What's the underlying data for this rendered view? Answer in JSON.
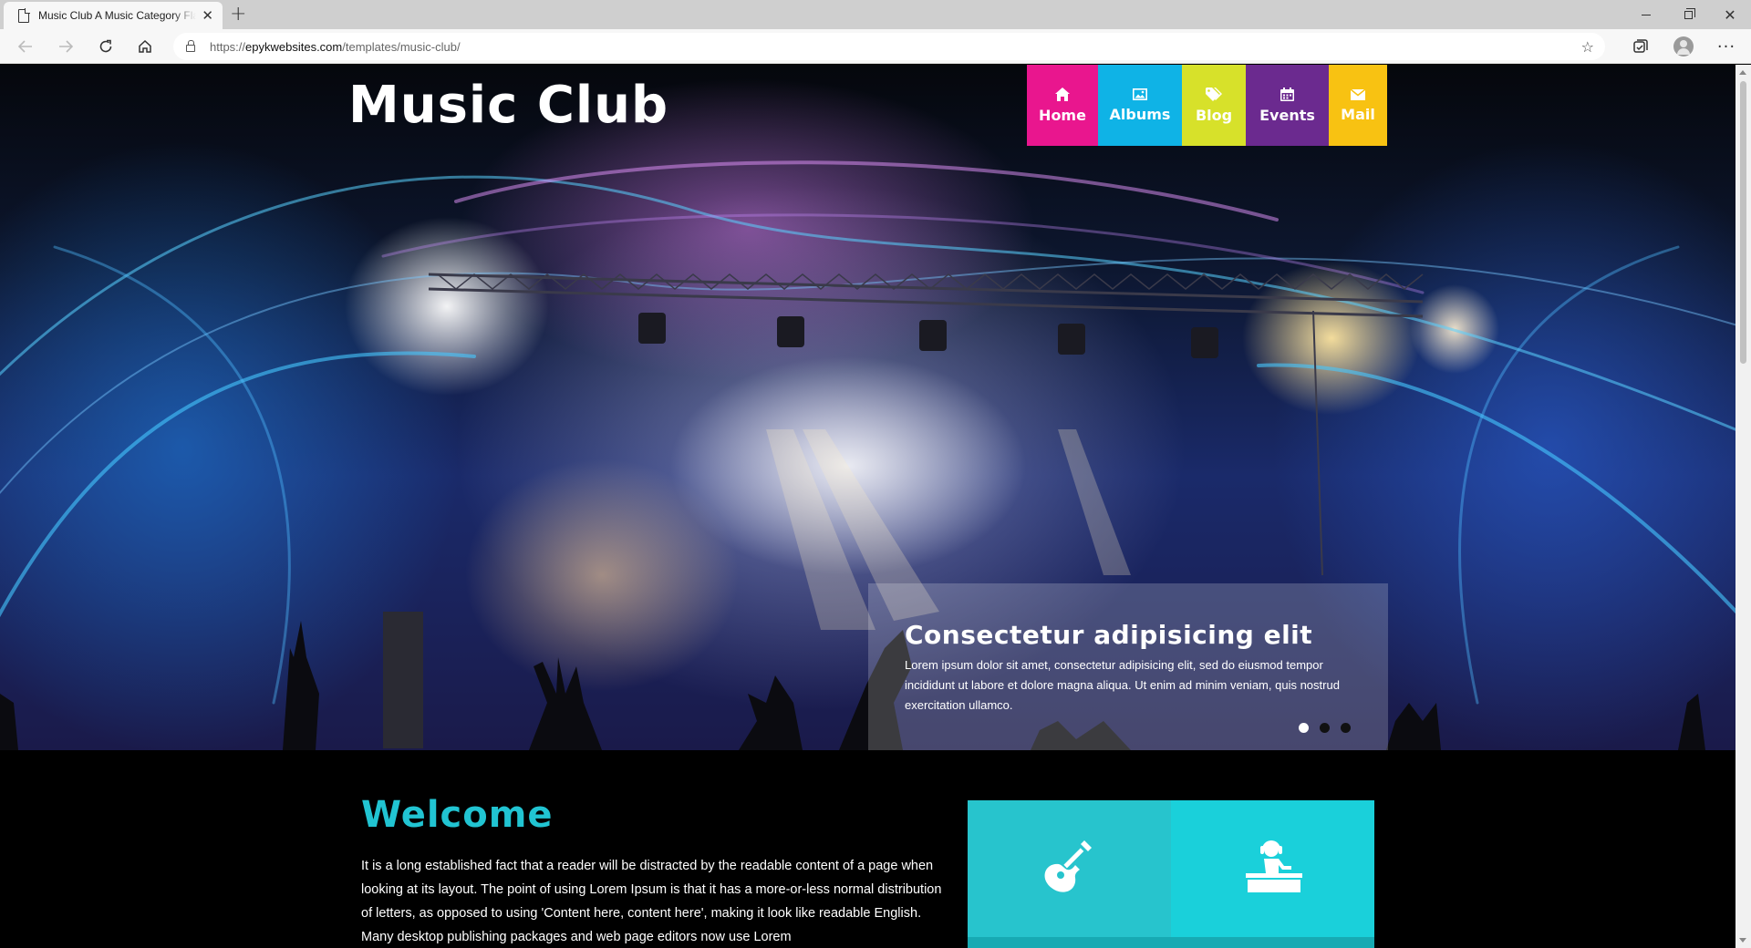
{
  "browser": {
    "tab_title": "Music Club A Music Category Flat Bootstrap Responsive Website Template",
    "tab_close": "✕",
    "new_tab": "+",
    "url_scheme": "https://",
    "url_host": "epykwebsites.com",
    "url_path": "/templates/music-club/"
  },
  "site": {
    "logo": "Music Club",
    "nav": [
      {
        "label": "Home",
        "icon": "home-icon",
        "color": "#e9168e"
      },
      {
        "label": "Albums",
        "icon": "picture-icon",
        "color": "#0fb3e6"
      },
      {
        "label": "Blog",
        "icon": "tags-icon",
        "color": "#d7e12a"
      },
      {
        "label": "Events",
        "icon": "calendar-icon",
        "color": "#6b2a8f"
      },
      {
        "label": "Mail",
        "icon": "envelope-icon",
        "color": "#f8c212"
      }
    ],
    "slider": {
      "heading": "Consectetur adipisicing elit",
      "text": "Lorem ipsum dolor sit amet, consectetur adipisicing elit, sed do eiusmod tempor incididunt ut labore et dolore magna aliqua. Ut enim ad minim veniam, quis nostrud exercitation ullamco.",
      "active_dot": 0
    },
    "welcome": {
      "title": "Welcome",
      "text": "It is a long established fact that a reader will be distracted by the readable content of a page when looking at its layout. The point of using Lorem Ipsum is that it has a more-or-less normal distribution of letters, as opposed to using 'Content here, content here', making it look like readable English. Many desktop publishing packages and web page editors now use Lorem"
    },
    "tiles": [
      {
        "icon": "guitar-icon",
        "color": "#27c4cd"
      },
      {
        "icon": "dj-icon",
        "color": "#1ad0da"
      }
    ]
  }
}
